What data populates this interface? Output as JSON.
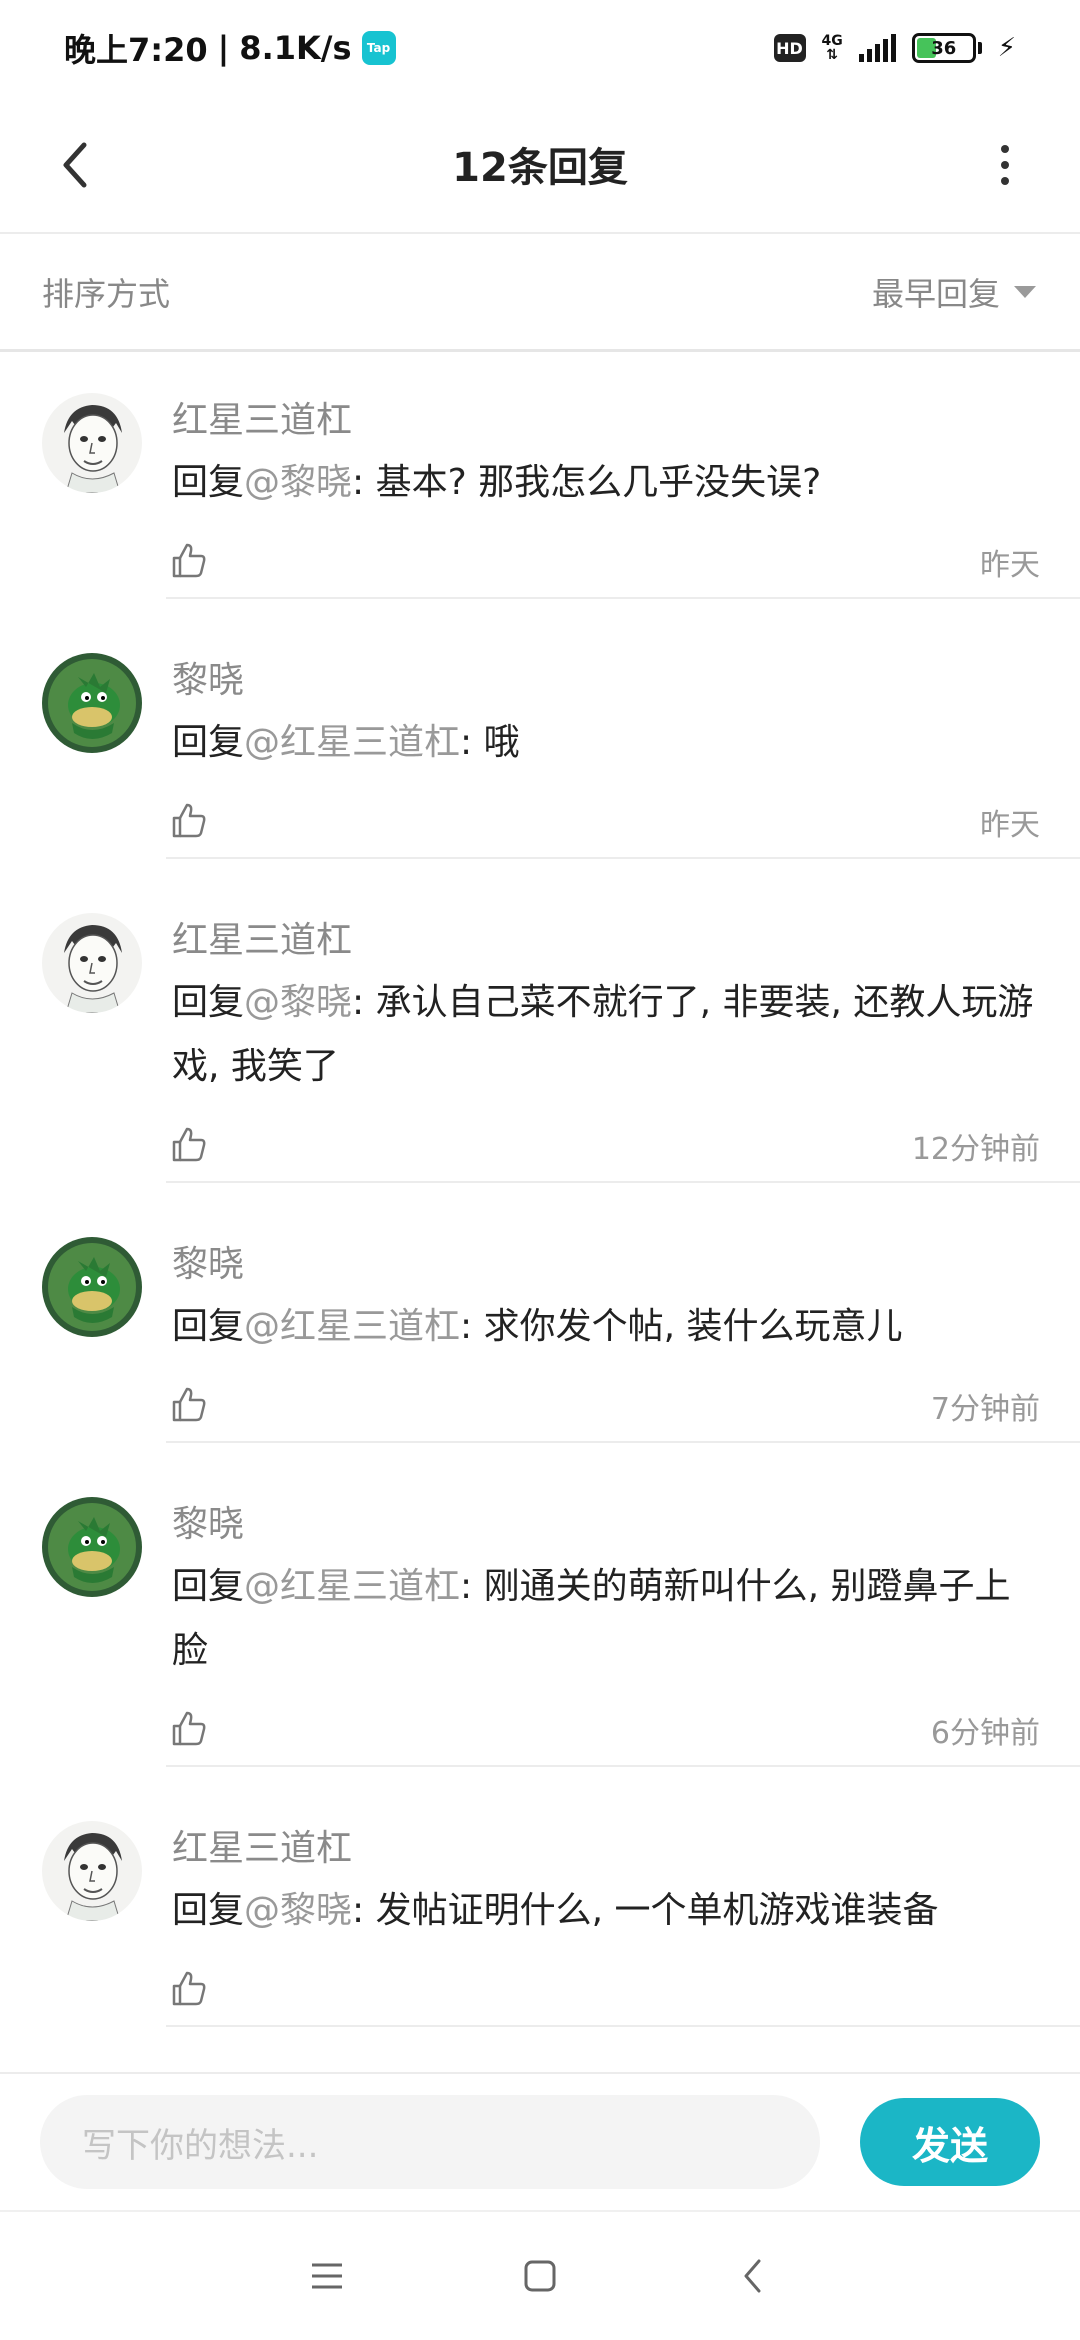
{
  "status_bar": {
    "time": "晚上7:20",
    "separator": "|",
    "speed": "8.1K/s",
    "app_badge": "Tap",
    "hd": "HD",
    "network": "4G",
    "battery": "36",
    "battery_level_percent": 36,
    "battery_fill_color": "#46c35a"
  },
  "header": {
    "title": "12条回复",
    "back_icon": "chevron-left-icon",
    "more_icon": "more-vertical-icon"
  },
  "sort": {
    "label": "排序方式",
    "selected": "最早回复"
  },
  "replies": [
    {
      "user": "红星三道杠",
      "avatar": "sketch-face-avatar",
      "prefix": "回复",
      "at": "@黎晓",
      "sep": ": ",
      "text": "基本? 那我怎么几乎没失误?",
      "time": "昨天"
    },
    {
      "user": "黎晓",
      "avatar": "green-dino-avatar",
      "prefix": "回复",
      "at": "@红星三道杠",
      "sep": ": ",
      "text": "哦",
      "time": "昨天"
    },
    {
      "user": "红星三道杠",
      "avatar": "sketch-face-avatar",
      "prefix": "回复",
      "at": "@黎晓",
      "sep": ": ",
      "text": "承认自己菜不就行了, 非要装, 还教人玩游戏, 我笑了",
      "time": "12分钟前"
    },
    {
      "user": "黎晓",
      "avatar": "green-dino-avatar",
      "prefix": "回复",
      "at": "@红星三道杠",
      "sep": ": ",
      "text": "求你发个帖, 装什么玩意儿",
      "time": "7分钟前"
    },
    {
      "user": "黎晓",
      "avatar": "green-dino-avatar",
      "prefix": "回复",
      "at": "@红星三道杠",
      "sep": ": ",
      "text": "刚通关的萌新叫什么, 别蹬鼻子上脸",
      "time": "6分钟前"
    },
    {
      "user": "红星三道杠",
      "avatar": "sketch-face-avatar",
      "prefix": "回复",
      "at": "@黎晓",
      "sep": ": ",
      "text": "发帖证明什么, 一个单机游戏谁装备",
      "time": ""
    }
  ],
  "composer": {
    "placeholder": "写下你的想法...",
    "send_label": "发送",
    "accent_color": "#1bb6c6"
  },
  "nav": {
    "menu_icon": "menu-icon",
    "home_icon": "home-square-icon",
    "back_icon": "back-triangle-icon"
  }
}
